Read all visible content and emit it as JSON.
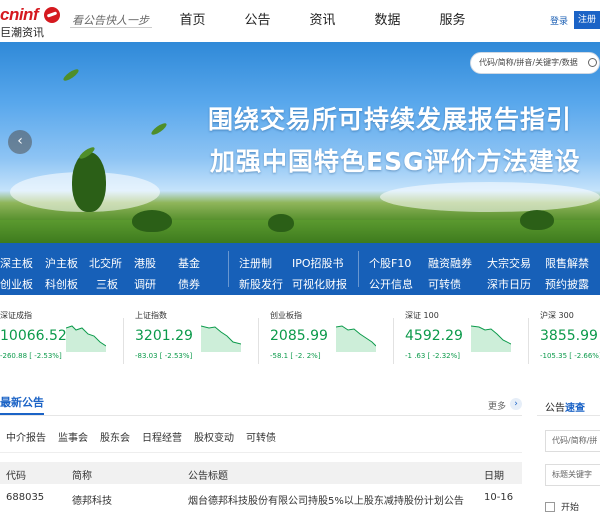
{
  "header": {
    "logo_text": "cninf",
    "logo_sub": "巨潮资讯",
    "slogan": "看公告快人一步",
    "nav": [
      "首页",
      "公告",
      "资讯",
      "数据",
      "服务"
    ],
    "login": "登录",
    "register": "注册"
  },
  "banner": {
    "search_placeholder": "代码/简称/拼音/关键字/数据",
    "title_line1": "围绕交易所可持续发展报告指引",
    "title_line2": "加强中国特色ESG评价方法建设"
  },
  "categories": {
    "row1": [
      "深主板",
      "沪主板",
      "北交所",
      "港股",
      "基金",
      "注册制",
      "IPO招股书",
      "个股F10",
      "融资融券",
      "大宗交易",
      "限售解禁"
    ],
    "row2": [
      "创业板",
      "科创板",
      "三板",
      "调研",
      "债券",
      "新股发行",
      "可视化财报",
      "公开信息",
      "可转债",
      "深市日历",
      "预约披露"
    ]
  },
  "indices": [
    {
      "name": "深证成指",
      "value": "10066.52",
      "change": "-260.88 [ -2.53%]"
    },
    {
      "name": "上证指数",
      "value": "3201.29",
      "change": "-83.03 [ -2.53%]"
    },
    {
      "name": "创业板指",
      "value": "2085.99",
      "change": "-58.1 [ -2. 2%]"
    },
    {
      "name": "深证 100",
      "value": "4592.29",
      "change": "-1 .63 [ -2.32%]"
    },
    {
      "name": "沪深 300",
      "value": "3855.99",
      "change": "-105.35 [ -2.66%]"
    }
  ],
  "announcements": {
    "title": "最新公告",
    "more": "更多",
    "tabs": [
      "中介报告",
      "监事会",
      "股东会",
      "日程经营",
      "股权变动",
      "可转债"
    ],
    "columns": [
      "代码",
      "简称",
      "公告标题",
      "日期"
    ],
    "rows": [
      {
        "code": "688035",
        "name": "德邦科技",
        "title": "烟台德邦科技股份有限公司持股5%以上股东减持股份计划公告",
        "date": "10-16"
      }
    ]
  },
  "quick_search": {
    "title_prefix": "公告",
    "title_highlight": "速查",
    "code_placeholder": "代码/简称/拼",
    "keyword_placeholder": "标题关键字",
    "option_label": "开始"
  },
  "colors": {
    "brand_red": "#d5191f",
    "primary_blue": "#1760b8",
    "index_green": "#0c9a4b"
  }
}
